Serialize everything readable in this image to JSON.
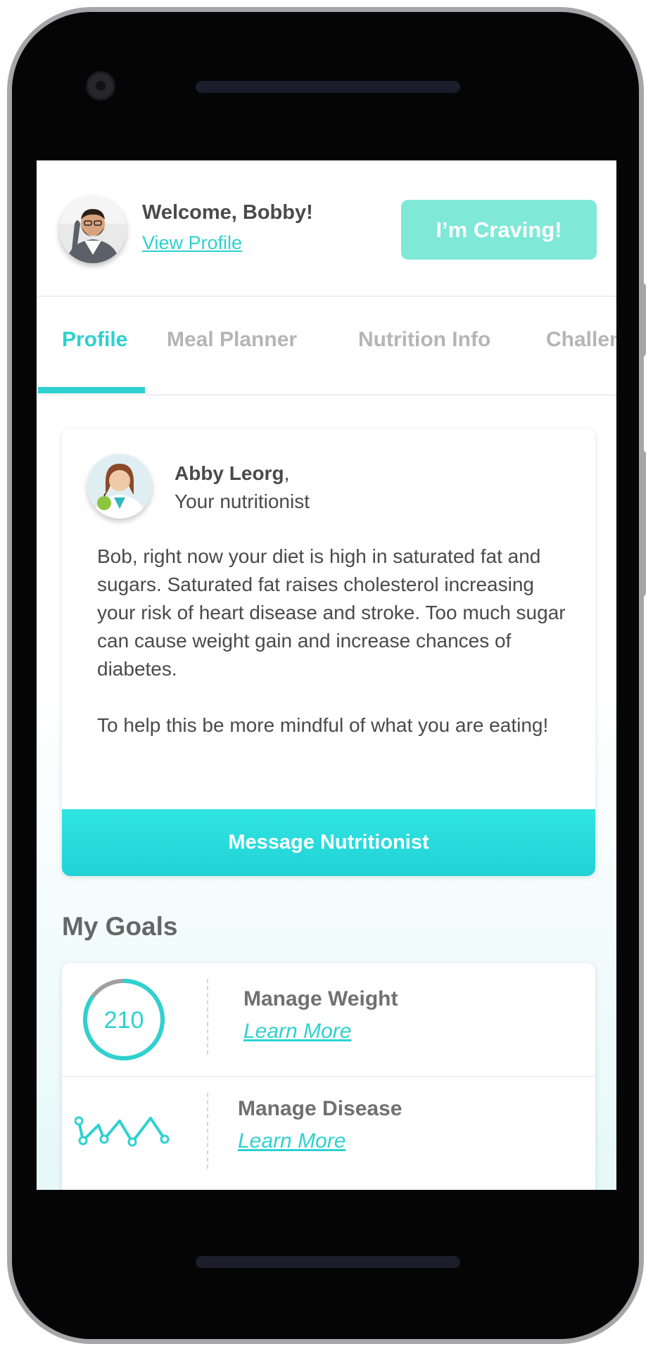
{
  "header": {
    "welcome": "Welcome, Bobby!",
    "view_profile": "View Profile",
    "craving_button": "I’m Craving!"
  },
  "tabs": [
    {
      "label": "Profile",
      "active": true
    },
    {
      "label": "Meal Planner",
      "active": false
    },
    {
      "label": "Nutrition Info",
      "active": false
    },
    {
      "label": "Challen",
      "active": false
    }
  ],
  "nutritionist": {
    "name": "Abby Leorg",
    "name_suffix": ",",
    "role": "Your nutritionist",
    "message_paragraphs": [
      "Bob, right now your diet is high in saturated fat and sugars. Saturated fat raises cholesterol increasing your risk of heart disease and stroke. Too much sugar can cause weight gain and increase chances of diabetes.",
      "To help this be more mindful of what you are eating!"
    ],
    "message_button": "Message Nutritionist"
  },
  "goals": {
    "title": "My Goals",
    "items": [
      {
        "value": "210",
        "title": "Manage Weight",
        "link": "Learn More",
        "progress": 0.85
      },
      {
        "title": "Manage Disease",
        "link": "Learn More"
      }
    ]
  },
  "colors": {
    "accent": "#2ed1d0",
    "craving_button_bg": "#7fe8d7",
    "text": "#4a4a4a",
    "inactive_tab": "#b5b5b5"
  }
}
